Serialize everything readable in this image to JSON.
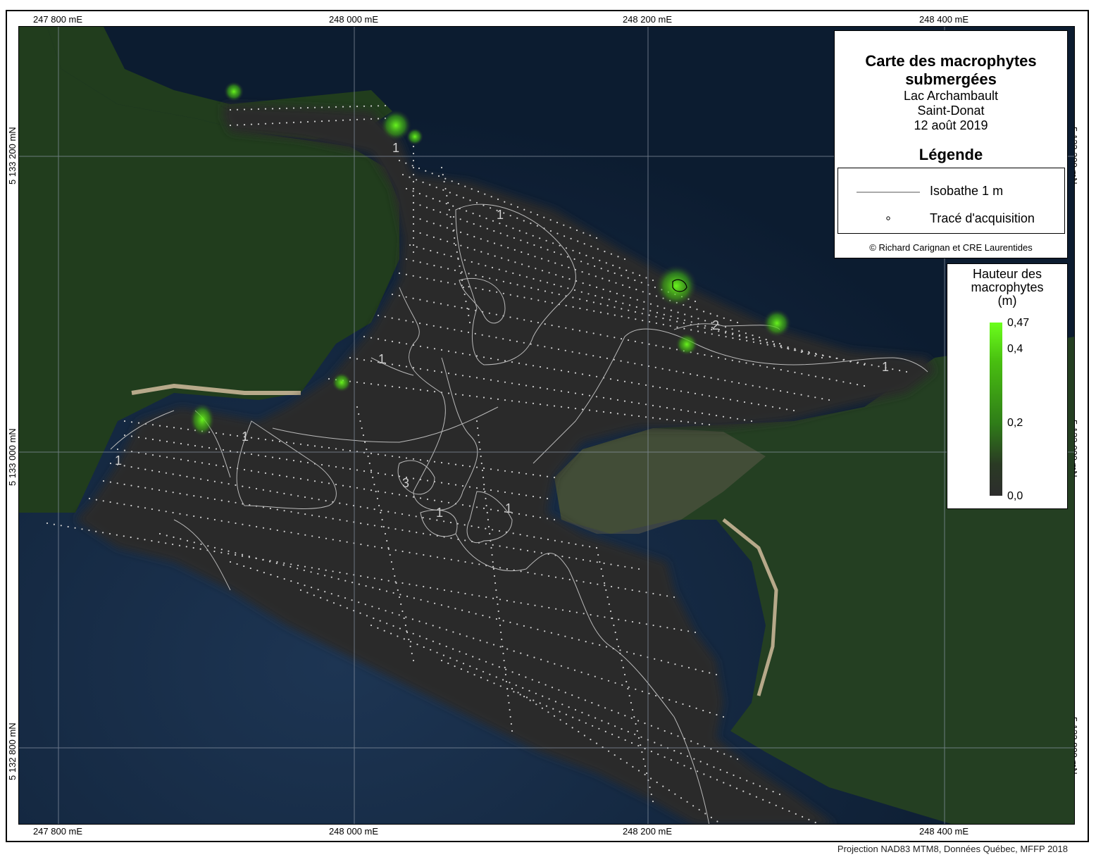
{
  "title": {
    "main": "Carte des macrophytes submergées",
    "lake": "Lac Archambault",
    "town": "Saint-Donat",
    "date": "12 août 2019"
  },
  "legend": {
    "heading": "Légende",
    "items": [
      {
        "symbol": "line",
        "label": "Isobathe 1 m"
      },
      {
        "symbol": "dot",
        "label": "Tracé d'acquisition"
      }
    ],
    "credit": "© Richard Carignan et CRE Laurentides"
  },
  "height_scale": {
    "title_line1": "Hauteur des",
    "title_line2": "macrophytes",
    "title_line3": "(m)",
    "labels": [
      "0,47",
      "0,4",
      "0,2",
      "0,0"
    ],
    "max": 0.47,
    "min": 0.0,
    "colors": [
      "#6cff1c",
      "#2d2d2d"
    ]
  },
  "axes": {
    "easting_ticks": [
      "247 800 mE",
      "248 000 mE",
      "248 200 mE",
      "248 400 mE"
    ],
    "northing_ticks": [
      "5 133 200 mN",
      "5 133 000 mN",
      "5 132 800 mN"
    ]
  },
  "isobath_labels": [
    "1",
    "1",
    "1",
    "2",
    "1",
    "1",
    "1",
    "1",
    "3",
    "1",
    "1"
  ],
  "footer": "Projection NAD83 MTM8, Données Québec, MFFP 2018",
  "colors": {
    "water": "#0d1e33",
    "survey_area": "#2b2b2b",
    "forest": "#1f3a1c",
    "macrophyte": "#6cff1c"
  }
}
